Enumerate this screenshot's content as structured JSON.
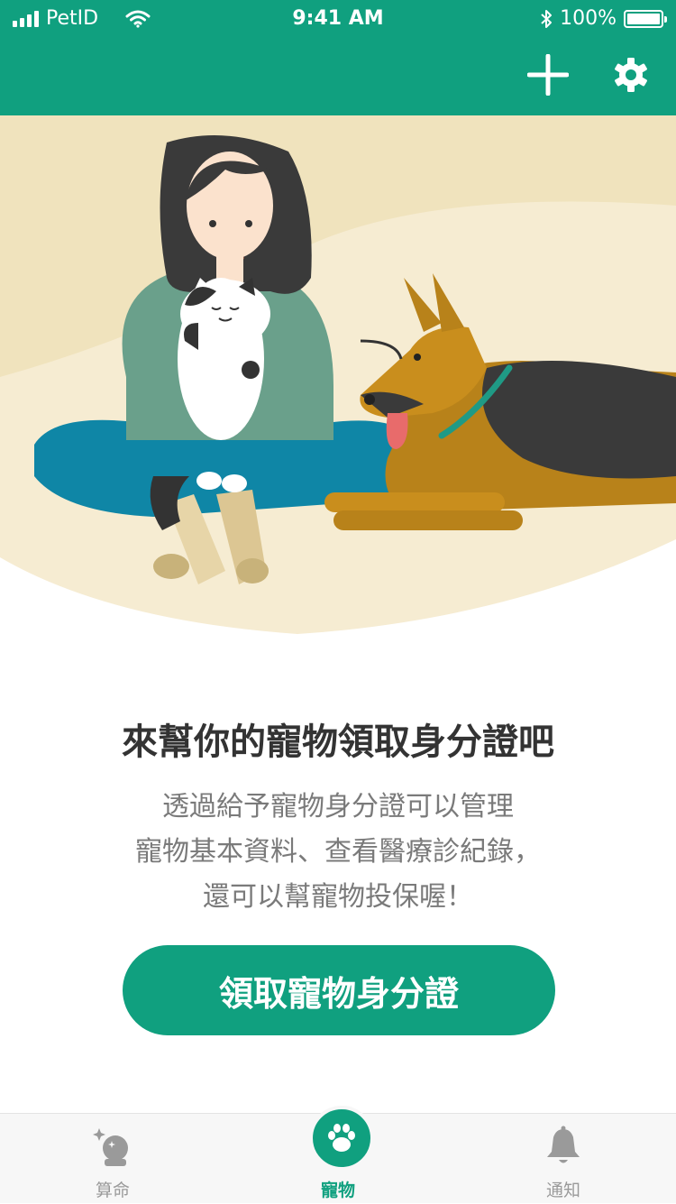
{
  "status_bar": {
    "carrier": "PetID",
    "time": "9:41 AM",
    "battery": "100%",
    "battery_level": 1.0
  },
  "header": {
    "add_icon": "plus-icon",
    "settings_icon": "gear-icon"
  },
  "main": {
    "title": "來幫你的寵物領取身分證吧",
    "description": [
      "透過給予寵物身分證可以管理",
      "寵物基本資料、查看醫療診紀錄，",
      "還可以幫寵物投保喔！"
    ],
    "cta_label": "領取寵物身分證"
  },
  "tabs": [
    {
      "label": "算命",
      "icon": "crystal-ball-icon",
      "active": false
    },
    {
      "label": "寵物",
      "icon": "paw-icon",
      "active": true
    },
    {
      "label": "通知",
      "icon": "bell-icon",
      "active": false
    }
  ],
  "colors": {
    "brand": "#10a07f",
    "hero_bg": "#f3e7c4",
    "text_primary": "#333333",
    "text_secondary": "#7a7a7a"
  }
}
